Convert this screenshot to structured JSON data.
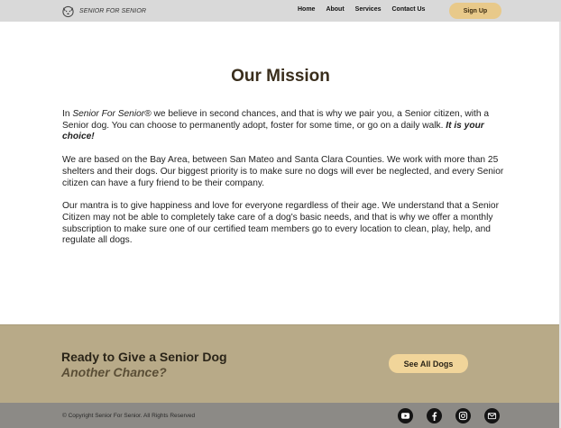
{
  "header": {
    "brand": "SENIOR FOR SENIOR",
    "nav": [
      {
        "label": "Home"
      },
      {
        "label": "About"
      },
      {
        "label": "Services"
      },
      {
        "label": "Contact Us"
      }
    ],
    "signup_label": "Sign Up"
  },
  "main": {
    "title": "Our Mission",
    "p1": {
      "intro": "In ",
      "brand": "Senior For Senior®",
      "body": " we believe in second chances, and that is why we pair you, a Senior citizen, with a Senior dog. You can choose to permanently adopt, foster for some time, or go on a daily walk. ",
      "emphasis": "It is your choice!"
    },
    "p2": "We are based on the Bay Area, between San Mateo and Santa Clara Counties. We work with more than 25 shelters and their dogs. Our biggest priority is to make sure no dogs will ever be neglected, and every Senior citizen can have a fury friend to be their company.",
    "p3": "Our mantra is to give happiness and love for everyone regardless of their age. We understand that a Senior Citizen may not be able to completely take care of a dog's basic needs, and that is why we offer a monthly subscription to make sure one of our certified team members go to every location to clean, play, help, and regulate all dogs."
  },
  "cta": {
    "line1": "Ready to Give a Senior Dog",
    "line2": "Another Chance?",
    "button_label": "See All Dogs"
  },
  "footer": {
    "copyright": "© Copyright Senior For Senior. All Rights Reserved",
    "socials": [
      "youtube-icon",
      "facebook-icon",
      "instagram-icon",
      "mail-icon"
    ]
  },
  "colors": {
    "header_bg": "#d9d9d9",
    "button_accent": "#e8c98a",
    "cta_bg": "#b8aa88",
    "footer_bg": "#8c8a86",
    "title_color": "#3a2e1c"
  }
}
